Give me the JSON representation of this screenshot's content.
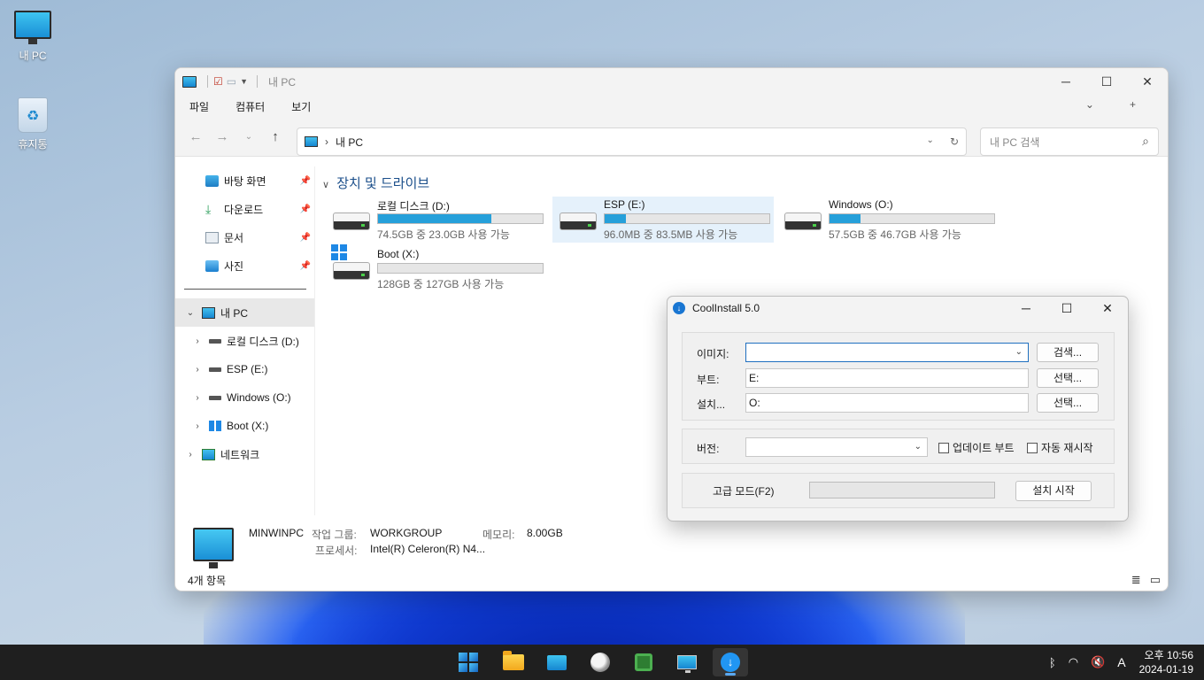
{
  "desktop": {
    "icons": [
      {
        "label": "내 PC",
        "icon": "monitor-icon"
      },
      {
        "label": "휴지통",
        "icon": "recycle-bin-icon"
      }
    ]
  },
  "explorer": {
    "title": "내 PC",
    "menu": [
      "파일",
      "컴퓨터",
      "보기"
    ],
    "address": {
      "path": "내 PC"
    },
    "search_placeholder": "내 PC 검색",
    "quick_access": [
      {
        "label": "바탕 화면",
        "icon": "desktop-icon"
      },
      {
        "label": "다운로드",
        "icon": "download-icon"
      },
      {
        "label": "문서",
        "icon": "document-icon"
      },
      {
        "label": "사진",
        "icon": "pictures-icon"
      }
    ],
    "tree": {
      "this_pc": "내 PC",
      "drives": [
        "로컬 디스크 (D:)",
        "ESP (E:)",
        "Windows (O:)",
        "Boot (X:)"
      ],
      "network": "네트워크"
    },
    "group_title": "장치 및 드라이브",
    "drives": [
      {
        "name": "로컬 디스크 (D:)",
        "free_text": "74.5GB 중 23.0GB 사용 가능",
        "used_fraction": 0.69
      },
      {
        "name": "ESP (E:)",
        "free_text": "96.0MB 중 83.5MB 사용 가능",
        "used_fraction": 0.13
      },
      {
        "name": "Windows (O:)",
        "free_text": "57.5GB 중 46.7GB 사용 가능",
        "used_fraction": 0.19
      },
      {
        "name": "Boot (X:)",
        "free_text": "128GB 중 127GB 사용 가능",
        "used_fraction": 0.0
      }
    ],
    "details": {
      "pc_name": "MINWINPC",
      "workgroup_label": "작업 그룹:",
      "workgroup": "WORKGROUP",
      "memory_label": "메모리:",
      "memory": "8.00GB",
      "cpu_label": "프로세서:",
      "cpu": "Intel(R) Celeron(R) N4..."
    },
    "status": "4개 항목"
  },
  "dialog": {
    "title": "CoolInstall 5.0",
    "image_label": "이미지:",
    "image_value": "",
    "search_button": "검색...",
    "boot_label": "부트:",
    "boot_value": "E:",
    "install_label": "설치...",
    "install_value": "O:",
    "select_button": "선택...",
    "version_label": "버전:",
    "version_value": "",
    "update_boot_label": "업데이트 부트",
    "update_boot_checked": false,
    "auto_restart_label": "자동 재시작",
    "auto_restart_checked": false,
    "advanced_label": "고급 모드(F2)",
    "progress": 0,
    "start_button": "설치 시작"
  },
  "taskbar": {
    "apps": [
      "start-icon",
      "file-explorer-icon",
      "monitor-app-icon",
      "anime-app-icon",
      "green-app-icon",
      "this-pc-app-icon",
      "coolinstall-app-icon"
    ],
    "ime": "A",
    "time": "오후 10:56",
    "date": "2024-01-19"
  }
}
